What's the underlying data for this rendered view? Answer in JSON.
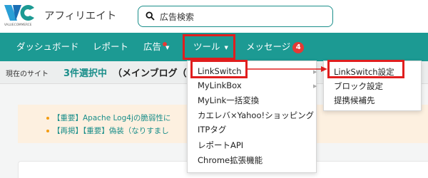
{
  "header": {
    "logo_text": "VALUECOMMERCE",
    "app_title": "アフィリエイト",
    "search_text": "広告検索"
  },
  "nav": {
    "dashboard": "ダッシュボード",
    "report": "レポート",
    "ads": "広告",
    "tools": "ツール",
    "messages": "メッセージ",
    "messages_badge": "4"
  },
  "site_bar": {
    "label": "現在のサイト",
    "count": "3件選択中",
    "name": "（メインブログ（ID"
  },
  "notices": [
    "【重要】Apache Log4jの脆弱性に",
    "【再掲】【重要】偽装（なりすまし"
  ],
  "tools_menu": {
    "items": [
      "LinkSwitch",
      "MyLinkBox",
      "MyLink一括変換",
      "カエレバ×Yahoo!ショッピング",
      "ITPタグ",
      "レポートAPI",
      "Chrome拡張機能"
    ]
  },
  "linkswitch_submenu": {
    "items": [
      "LinkSwitch設定",
      "ブロック設定",
      "提携候補先"
    ]
  },
  "colors": {
    "brand_teal": "#1c9a93",
    "highlight_red": "#e01e1e",
    "badge_red": "#e53935",
    "notice_bg": "#fdf0e0"
  },
  "icons": [
    "vc-logo-icon",
    "search-icon",
    "chevron-down-icon",
    "chevron-right-icon"
  ]
}
